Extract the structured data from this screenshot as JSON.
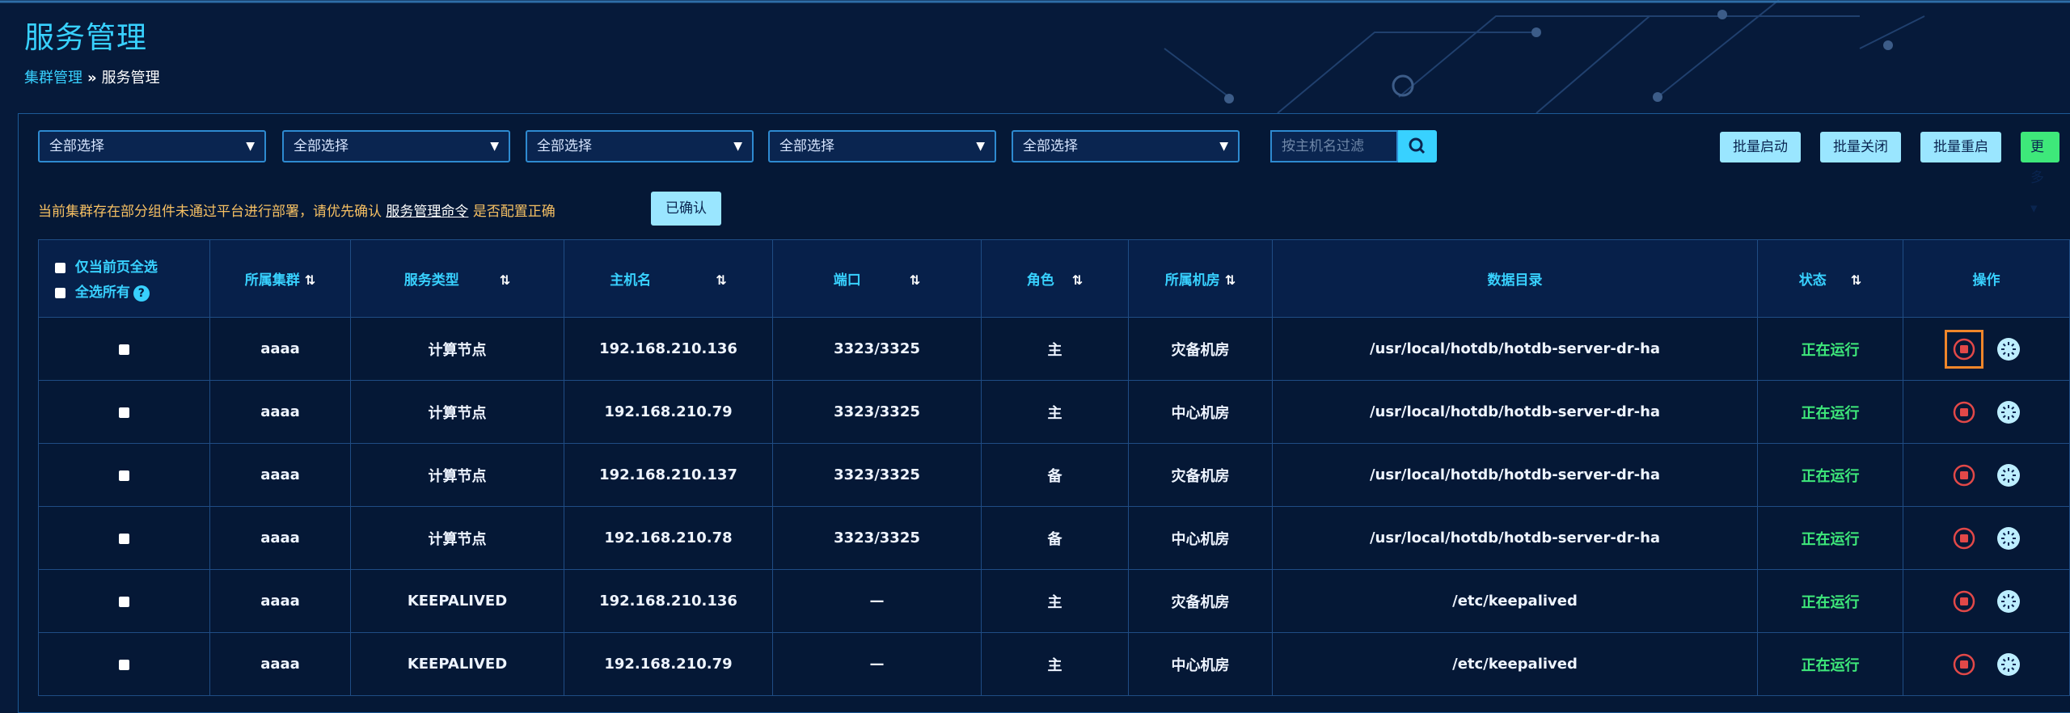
{
  "header": {
    "title": "服务管理",
    "breadcrumb": {
      "parent": "集群管理",
      "separator": "»",
      "current": "服务管理"
    }
  },
  "filters": {
    "selects": [
      "全部选择",
      "全部选择",
      "全部选择",
      "全部选择",
      "全部选择"
    ],
    "search_placeholder": "按主机名过滤",
    "search_icon": "search-icon"
  },
  "batch_actions": {
    "start": "批量启动",
    "stop": "批量关闭",
    "restart": "批量重启",
    "more": "更多"
  },
  "notice": {
    "text_before": "当前集群存在部分组件未通过平台进行部署，请优先确认",
    "link": "服务管理命令",
    "text_after": "是否配置正确",
    "confirm_button": "已确认"
  },
  "table": {
    "select_current_page": "仅当前页全选",
    "select_all": "全选所有",
    "columns": [
      "所属集群",
      "服务类型",
      "主机名",
      "端口",
      "角色",
      "所属机房",
      "数据目录",
      "状态",
      "操作"
    ],
    "rows": [
      {
        "cluster": "aaaa",
        "type": "计算节点",
        "host": "192.168.210.136",
        "port": "3323/3325",
        "role": "主",
        "room": "灾备机房",
        "dir": "/usr/local/hotdb/hotdb-server-dr-ha",
        "status": "正在运行"
      },
      {
        "cluster": "aaaa",
        "type": "计算节点",
        "host": "192.168.210.79",
        "port": "3323/3325",
        "role": "主",
        "room": "中心机房",
        "dir": "/usr/local/hotdb/hotdb-server-dr-ha",
        "status": "正在运行"
      },
      {
        "cluster": "aaaa",
        "type": "计算节点",
        "host": "192.168.210.137",
        "port": "3323/3325",
        "role": "备",
        "room": "灾备机房",
        "dir": "/usr/local/hotdb/hotdb-server-dr-ha",
        "status": "正在运行"
      },
      {
        "cluster": "aaaa",
        "type": "计算节点",
        "host": "192.168.210.78",
        "port": "3323/3325",
        "role": "备",
        "room": "中心机房",
        "dir": "/usr/local/hotdb/hotdb-server-dr-ha",
        "status": "正在运行"
      },
      {
        "cluster": "aaaa",
        "type": "KEEPALIVED",
        "host": "192.168.210.136",
        "port": "—",
        "role": "主",
        "room": "灾备机房",
        "dir": "/etc/keepalived",
        "status": "正在运行"
      },
      {
        "cluster": "aaaa",
        "type": "KEEPALIVED",
        "host": "192.168.210.79",
        "port": "—",
        "role": "主",
        "room": "中心机房",
        "dir": "/etc/keepalived",
        "status": "正在运行"
      }
    ]
  },
  "colors": {
    "accent": "#38d1ff",
    "running": "#3ee87a",
    "warning": "#f6c063",
    "stop": "#e24848",
    "highlight": "#f0862a"
  }
}
